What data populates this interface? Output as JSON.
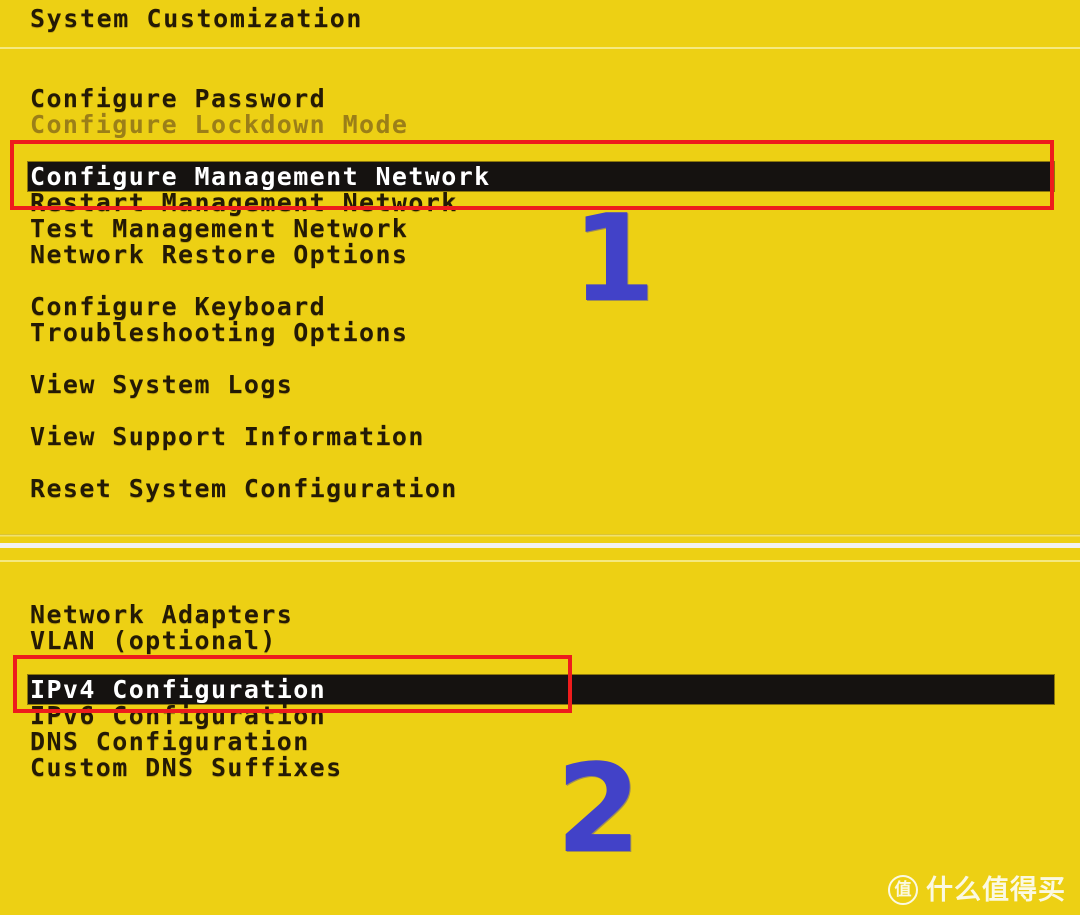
{
  "colors": {
    "screen_background": "#EDD014",
    "text": "#241a05",
    "text_disabled": "#9b7f18",
    "highlight_bar": "#151210",
    "highlight_text": "#ffffff",
    "annotation_box": "#ee1c1c",
    "annotation_number": "#4242c8",
    "watermark": "#fdfdf4",
    "separator": "#f6ea86"
  },
  "top_screen": {
    "title": "System Customization",
    "items": [
      {
        "label": "Configure Password",
        "state": "normal"
      },
      {
        "label": "Configure Lockdown Mode",
        "state": "disabled"
      },
      {
        "label": "Configure Management Network",
        "state": "selected"
      },
      {
        "label": "Restart Management Network",
        "state": "normal"
      },
      {
        "label": "Test Management Network",
        "state": "normal"
      },
      {
        "label": "Network Restore Options",
        "state": "normal"
      },
      {
        "label": "Configure Keyboard",
        "state": "normal"
      },
      {
        "label": "Troubleshooting Options",
        "state": "normal"
      },
      {
        "label": "View System Logs",
        "state": "normal"
      },
      {
        "label": "View Support Information",
        "state": "normal"
      },
      {
        "label": "Reset System Configuration",
        "state": "normal"
      }
    ],
    "annotation": {
      "number": "1"
    }
  },
  "bottom_screen": {
    "items": [
      {
        "label": "Network Adapters",
        "state": "normal"
      },
      {
        "label": "VLAN (optional)",
        "state": "normal"
      },
      {
        "label": "IPv4 Configuration",
        "state": "selected"
      },
      {
        "label": "IPv6 Configuration",
        "state": "normal"
      },
      {
        "label": "DNS Configuration",
        "state": "normal"
      },
      {
        "label": "Custom DNS Suffixes",
        "state": "normal"
      }
    ],
    "annotation": {
      "number": "2"
    }
  },
  "watermark": {
    "logo_glyph": "值",
    "text": "什么值得买"
  }
}
